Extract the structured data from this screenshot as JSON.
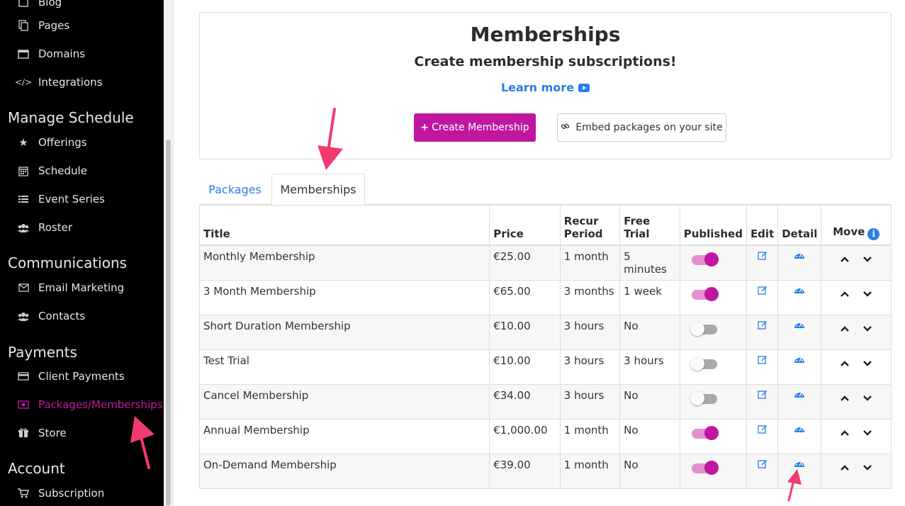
{
  "sidebar": {
    "top_items": [
      {
        "label": "Blog",
        "icon": "blog-icon"
      },
      {
        "label": "Pages",
        "icon": "pages-icon"
      },
      {
        "label": "Domains",
        "icon": "domains-icon"
      },
      {
        "label": "Integrations",
        "icon": "code-icon"
      }
    ],
    "sections": [
      {
        "heading": "Manage Schedule",
        "items": [
          {
            "label": "Offerings",
            "icon": "star-icon"
          },
          {
            "label": "Schedule",
            "icon": "calendar-icon"
          },
          {
            "label": "Event Series",
            "icon": "list-icon"
          },
          {
            "label": "Roster",
            "icon": "users-icon"
          }
        ]
      },
      {
        "heading": "Communications",
        "items": [
          {
            "label": "Email Marketing",
            "icon": "envelope-icon"
          },
          {
            "label": "Contacts",
            "icon": "users-icon"
          }
        ]
      },
      {
        "heading": "Payments",
        "items": [
          {
            "label": "Client Payments",
            "icon": "credit-card-icon"
          },
          {
            "label": "Packages/Memberships",
            "icon": "money-icon",
            "active": true
          },
          {
            "label": "Store",
            "icon": "gift-icon"
          }
        ]
      },
      {
        "heading": "Account",
        "items": [
          {
            "label": "Subscription",
            "icon": "cart-icon"
          }
        ]
      }
    ],
    "active_color": "#c2189f"
  },
  "header": {
    "title": "Memberships",
    "subtitle": "Create membership subscriptions!",
    "learn_more": "Learn more",
    "create_button": "Create Membership",
    "embed_button": "Embed packages on your site"
  },
  "tabs": [
    {
      "label": "Packages",
      "active": false
    },
    {
      "label": "Memberships",
      "active": true
    }
  ],
  "table": {
    "headers": {
      "title": "Title",
      "price": "Price",
      "recur_line1": "Recur",
      "recur_line2": "Period",
      "trial": "Free Trial",
      "published": "Published",
      "edit": "Edit",
      "detail": "Detail",
      "move": "Move"
    },
    "rows": [
      {
        "title": "Monthly Membership",
        "price": "€25.00",
        "recur": "1 month",
        "trial": "5 minutes",
        "published": true
      },
      {
        "title": "3 Month Membership",
        "price": "€65.00",
        "recur": "3 months",
        "trial": "1 week",
        "published": true
      },
      {
        "title": "Short Duration Membership",
        "price": "€10.00",
        "recur": "3 hours",
        "trial": "No",
        "published": false
      },
      {
        "title": "Test Trial",
        "price": "€10.00",
        "recur": "3 hours",
        "trial": "3 hours",
        "published": false
      },
      {
        "title": "Cancel Membership",
        "price": "€34.00",
        "recur": "3 hours",
        "trial": "No",
        "published": false
      },
      {
        "title": "Annual Membership",
        "price": "€1,000.00",
        "recur": "1 month",
        "trial": "No",
        "published": true
      },
      {
        "title": "On-Demand Membership",
        "price": "€39.00",
        "recur": "1 month",
        "trial": "No",
        "published": true
      }
    ]
  },
  "colors": {
    "brand": "#c0179f",
    "link": "#2b7de9",
    "annotation_arrow": "#f23a6e"
  }
}
